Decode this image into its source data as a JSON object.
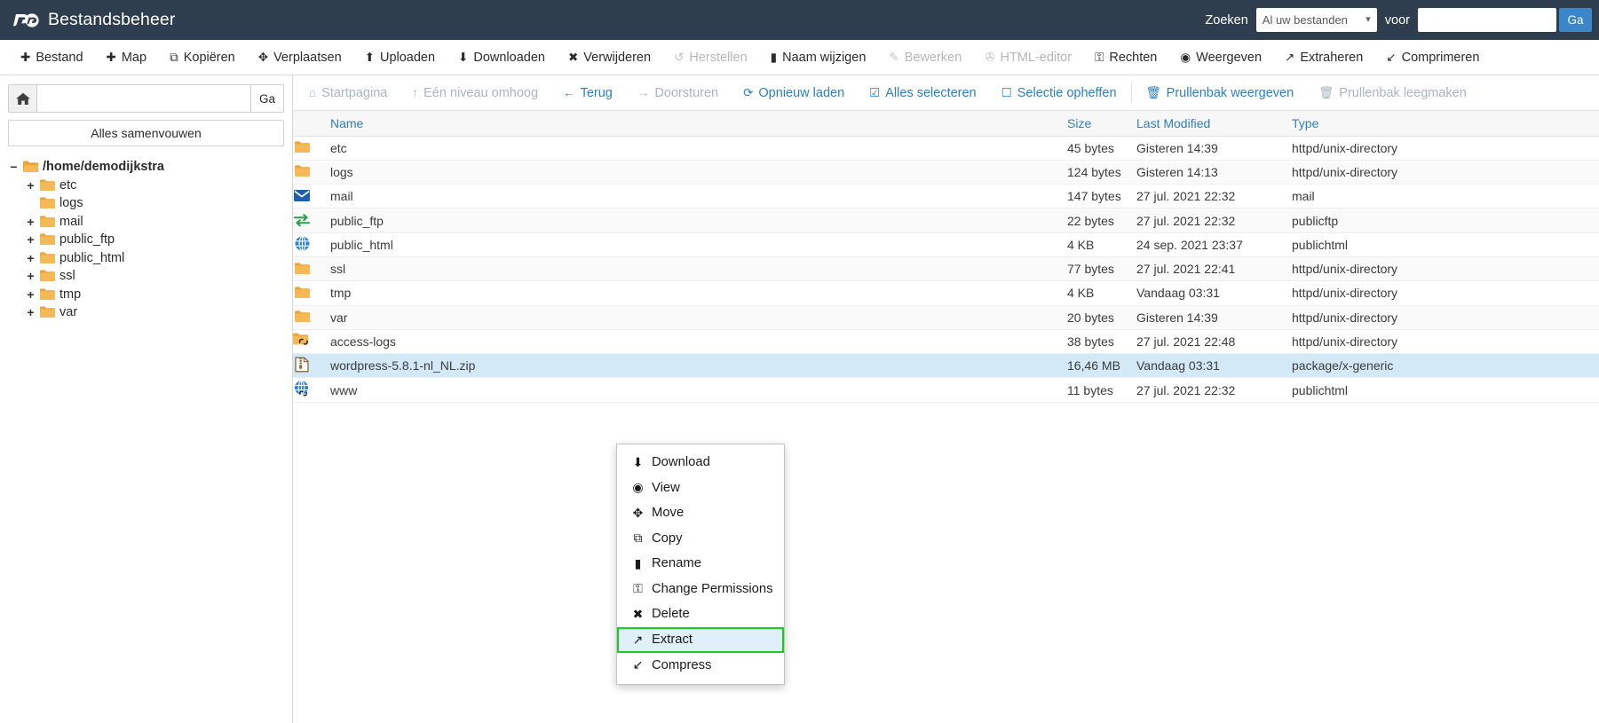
{
  "header": {
    "app_title": "Bestandsbeheer",
    "logo_icon": "cpanel-logo-icon",
    "search_label": "Zoeken",
    "search_scope_value": "Al uw bestanden",
    "search_scope_caret": "chevron-down-icon",
    "search_for_label": "voor",
    "search_input_value": "",
    "search_input_placeholder": "",
    "search_go_label": "Ga",
    "accent_blue": "#3a86c8",
    "header_bg": "#2e3e4e"
  },
  "toolbar": {
    "items": [
      {
        "label": "Bestand",
        "icon": "plus-icon",
        "glyph": "✚",
        "disabled": false
      },
      {
        "label": "Map",
        "icon": "plus-icon",
        "glyph": "✚",
        "disabled": false
      },
      {
        "label": "Kopiëren",
        "icon": "copy-icon",
        "glyph": "⧉",
        "disabled": false
      },
      {
        "label": "Verplaatsen",
        "icon": "move-icon",
        "glyph": "✥",
        "disabled": false
      },
      {
        "label": "Uploaden",
        "icon": "upload-icon",
        "glyph": "⬆",
        "disabled": false
      },
      {
        "label": "Downloaden",
        "icon": "download-icon",
        "glyph": "⬇",
        "disabled": false
      },
      {
        "label": "Verwijderen",
        "icon": "close-x-icon",
        "glyph": "✖",
        "disabled": false
      },
      {
        "label": "Herstellen",
        "icon": "undo-icon",
        "glyph": "↺",
        "disabled": true
      },
      {
        "label": "Naam wijzigen",
        "icon": "file-icon",
        "glyph": "▮",
        "disabled": false
      },
      {
        "label": "Bewerken",
        "icon": "pencil-icon",
        "glyph": "✎",
        "disabled": true
      },
      {
        "label": "HTML-editor",
        "icon": "html-editor-icon",
        "glyph": "✇",
        "disabled": true
      },
      {
        "label": "Rechten",
        "icon": "key-icon",
        "glyph": "⚿",
        "disabled": false
      },
      {
        "label": "Weergeven",
        "icon": "eye-icon",
        "glyph": "◉",
        "disabled": false
      },
      {
        "label": "Extraheren",
        "icon": "extract-icon",
        "glyph": "↗",
        "disabled": false
      },
      {
        "label": "Comprimeren",
        "icon": "compress-icon",
        "glyph": "↙",
        "disabled": false
      }
    ]
  },
  "sidebar": {
    "home_icon": "home-icon",
    "path_value": "",
    "path_placeholder": "",
    "go_label": "Ga",
    "collapse_all_label": "Alles samenvouwen",
    "tree": {
      "root": {
        "label": "/home/demodijkstra",
        "toggle": "−",
        "icon": "folder-open-icon"
      },
      "children": [
        {
          "label": "etc",
          "toggle": "+",
          "icon": "folder-icon"
        },
        {
          "label": "logs",
          "toggle": "",
          "icon": "folder-icon"
        },
        {
          "label": "mail",
          "toggle": "+",
          "icon": "folder-icon"
        },
        {
          "label": "public_ftp",
          "toggle": "+",
          "icon": "folder-icon"
        },
        {
          "label": "public_html",
          "toggle": "+",
          "icon": "folder-icon"
        },
        {
          "label": "ssl",
          "toggle": "+",
          "icon": "folder-icon"
        },
        {
          "label": "tmp",
          "toggle": "+",
          "icon": "folder-icon"
        },
        {
          "label": "var",
          "toggle": "+",
          "icon": "folder-icon"
        }
      ]
    }
  },
  "navbar": {
    "items": [
      {
        "label": "Startpagina",
        "icon": "home-icon",
        "glyph": "⌂",
        "disabled": true
      },
      {
        "label": "Eén niveau omhoog",
        "icon": "level-up-icon",
        "glyph": "↑",
        "disabled": true
      },
      {
        "label": "Terug",
        "icon": "arrow-left-icon",
        "glyph": "←",
        "disabled": false
      },
      {
        "label": "Doorsturen",
        "icon": "arrow-right-icon",
        "glyph": "→",
        "disabled": true
      },
      {
        "label": "Opnieuw laden",
        "icon": "refresh-icon",
        "glyph": "⟳",
        "disabled": false
      },
      {
        "label": "Alles selecteren",
        "icon": "checkbox-checked-icon",
        "glyph": "☑",
        "disabled": false
      },
      {
        "label": "Selectie opheffen",
        "icon": "checkbox-empty-icon",
        "glyph": "☐",
        "disabled": false
      },
      {
        "label": "Prullenbak weergeven",
        "icon": "trash-icon",
        "glyph": "🗑",
        "disabled": false
      },
      {
        "label": "Prullenbak leegmaken",
        "icon": "trash-icon",
        "glyph": "🗑",
        "disabled": true
      }
    ]
  },
  "table": {
    "columns": [
      "Name",
      "Size",
      "Last Modified",
      "Type"
    ],
    "rows": [
      {
        "name": "etc",
        "size": "45 bytes",
        "modified": "Gisteren 14:39",
        "type": "httpd/unix-directory",
        "icon": "folder-icon",
        "selected": false
      },
      {
        "name": "logs",
        "size": "124 bytes",
        "modified": "Gisteren 14:13",
        "type": "httpd/unix-directory",
        "icon": "folder-icon",
        "selected": false
      },
      {
        "name": "mail",
        "size": "147 bytes",
        "modified": "27 jul. 2021 22:32",
        "type": "mail",
        "icon": "mail-icon",
        "selected": false
      },
      {
        "name": "public_ftp",
        "size": "22 bytes",
        "modified": "27 jul. 2021 22:32",
        "type": "publicftp",
        "icon": "ftp-transfer-icon",
        "selected": false
      },
      {
        "name": "public_html",
        "size": "4 KB",
        "modified": "24 sep. 2021 23:37",
        "type": "publichtml",
        "icon": "globe-icon",
        "selected": false
      },
      {
        "name": "ssl",
        "size": "77 bytes",
        "modified": "27 jul. 2021 22:41",
        "type": "httpd/unix-directory",
        "icon": "folder-icon",
        "selected": false
      },
      {
        "name": "tmp",
        "size": "4 KB",
        "modified": "Vandaag 03:31",
        "type": "httpd/unix-directory",
        "icon": "folder-icon",
        "selected": false
      },
      {
        "name": "var",
        "size": "20 bytes",
        "modified": "Gisteren 14:39",
        "type": "httpd/unix-directory",
        "icon": "folder-icon",
        "selected": false
      },
      {
        "name": "access-logs",
        "size": "38 bytes",
        "modified": "27 jul. 2021 22:48",
        "type": "httpd/unix-directory",
        "icon": "folder-symlink-icon",
        "selected": false
      },
      {
        "name": "wordpress-5.8.1-nl_NL.zip",
        "size": "16,46 MB",
        "modified": "Vandaag 03:31",
        "type": "package/x-generic",
        "icon": "archive-file-icon",
        "selected": true
      },
      {
        "name": "www",
        "size": "11 bytes",
        "modified": "27 jul. 2021 22:32",
        "type": "publichtml",
        "icon": "globe-symlink-icon",
        "selected": false
      }
    ]
  },
  "context_menu": {
    "highlight_color": "#16d11c",
    "highlight_bg": "#dff0fa",
    "items": [
      {
        "label": "Download",
        "icon": "download-icon",
        "glyph": "⬇",
        "highlighted": false
      },
      {
        "label": "View",
        "icon": "eye-icon",
        "glyph": "◉",
        "highlighted": false
      },
      {
        "label": "Move",
        "icon": "move-icon",
        "glyph": "✥",
        "highlighted": false
      },
      {
        "label": "Copy",
        "icon": "copy-icon",
        "glyph": "⧉",
        "highlighted": false
      },
      {
        "label": "Rename",
        "icon": "file-icon",
        "glyph": "▮",
        "highlighted": false
      },
      {
        "label": "Change Permissions",
        "icon": "key-icon",
        "glyph": "⚿",
        "highlighted": false
      },
      {
        "label": "Delete",
        "icon": "close-x-icon",
        "glyph": "✖",
        "highlighted": false
      },
      {
        "label": "Extract",
        "icon": "extract-icon",
        "glyph": "↗",
        "highlighted": true
      },
      {
        "label": "Compress",
        "icon": "compress-icon",
        "glyph": "↙",
        "highlighted": false
      }
    ]
  }
}
